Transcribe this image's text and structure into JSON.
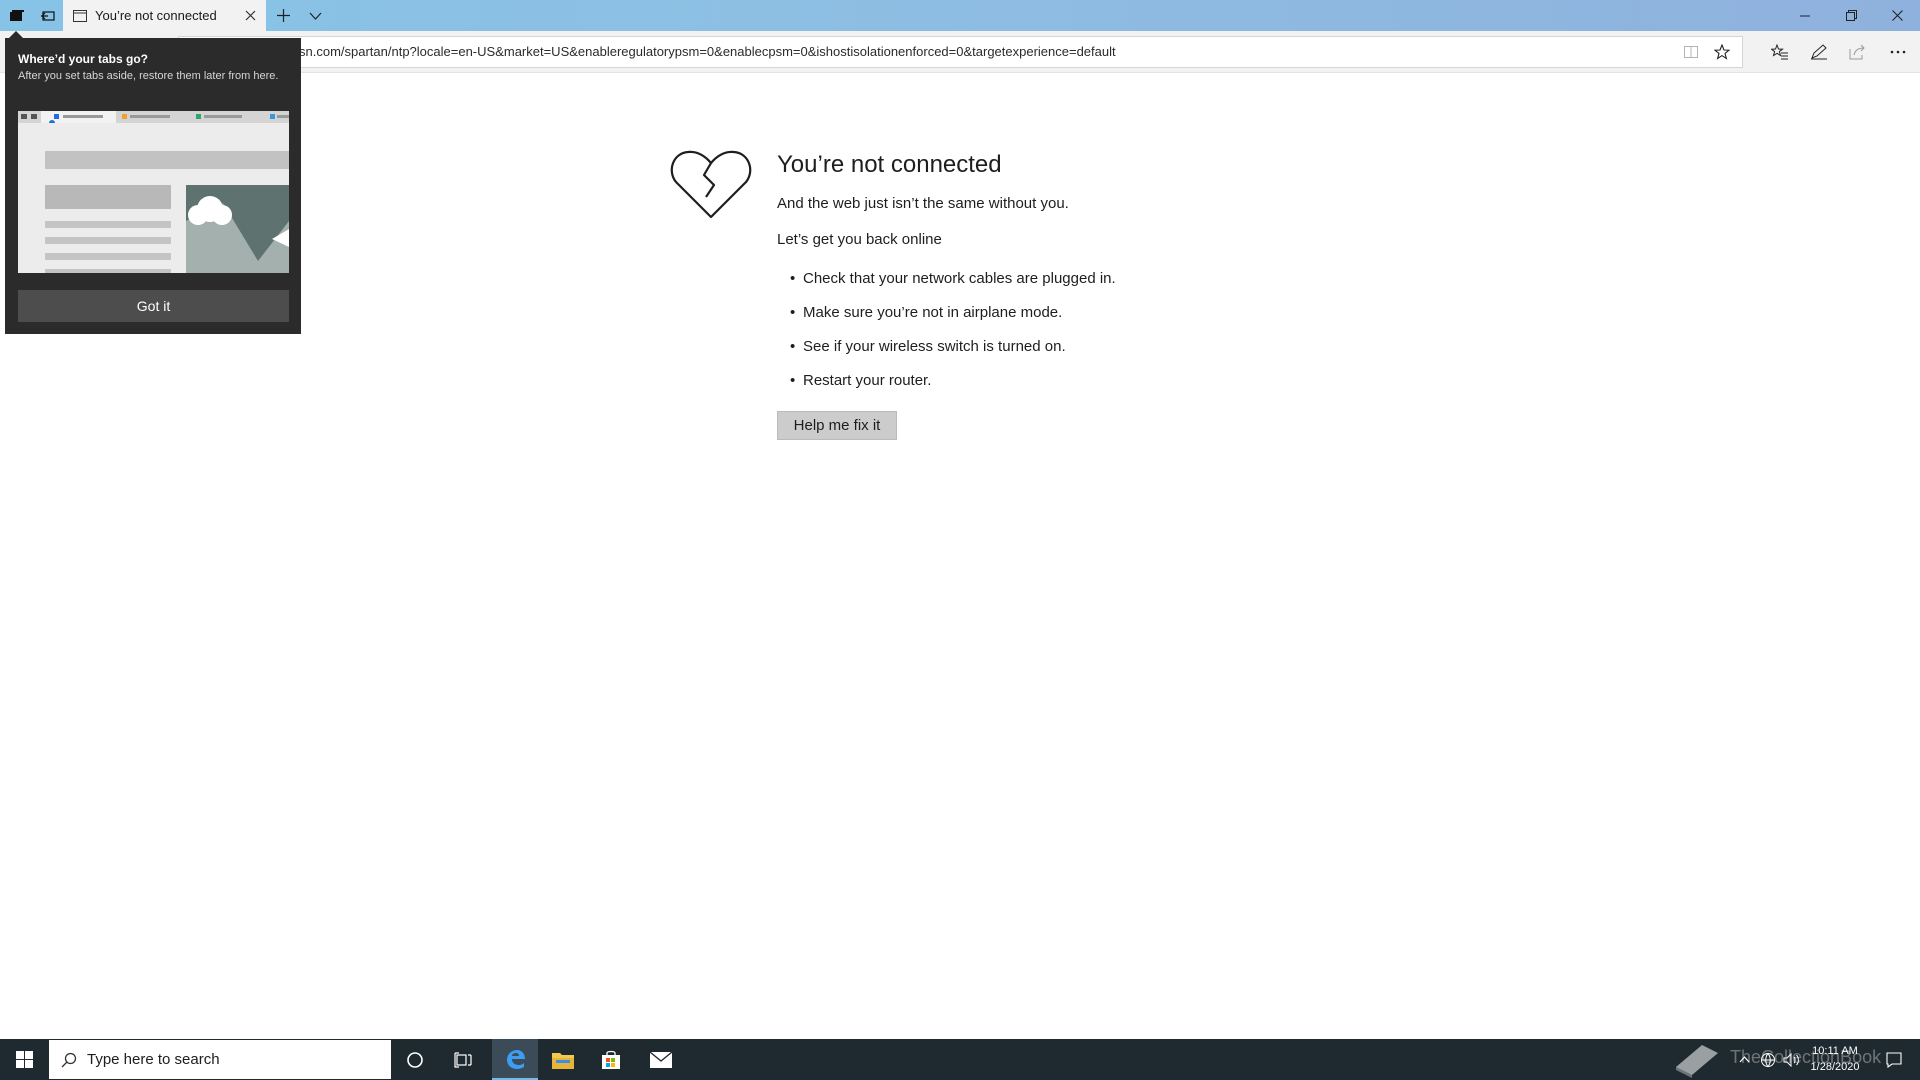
{
  "browser": {
    "tab_title": "You’re not connected",
    "address": "sn.com/spartan/ntp?locale=en-US&market=US&enableregulatorypsm=0&enablecpsm=0&ishostisolationenforced=0&targetexperience=default"
  },
  "popup": {
    "title": "Where’d your tabs go?",
    "body": "After you set tabs aside, restore them later from here.",
    "button": "Got it"
  },
  "error_page": {
    "title": "You’re not connected",
    "subtitle": "And the web just isn’t the same without you.",
    "section": "Let’s get you back online",
    "tips": [
      "Check that your network cables are plugged in.",
      "Make sure you’re not in airplane mode.",
      "See if your wireless switch is turned on.",
      "Restart your router."
    ],
    "fix_button": "Help me fix it"
  },
  "taskbar": {
    "search_placeholder": "Type here to search",
    "time": "10:11 AM",
    "date": "1/28/2020",
    "watermark": "TheCollectionBook"
  },
  "icons": [
    "tabs-aside-icon",
    "restore-tabs-icon",
    "page-icon",
    "close-icon",
    "new-tab-icon",
    "chevron-down-icon",
    "minimize-icon",
    "restore-icon",
    "reading-view-icon",
    "favorite-star-icon",
    "favorites-hub-icon",
    "pen-icon",
    "share-icon",
    "more-icon",
    "broken-heart-icon",
    "windows-start-icon",
    "search-icon",
    "cortana-icon",
    "task-view-icon",
    "edge-icon",
    "file-explorer-icon",
    "store-icon",
    "mail-icon",
    "network-icon",
    "volume-icon",
    "notification-icon"
  ]
}
